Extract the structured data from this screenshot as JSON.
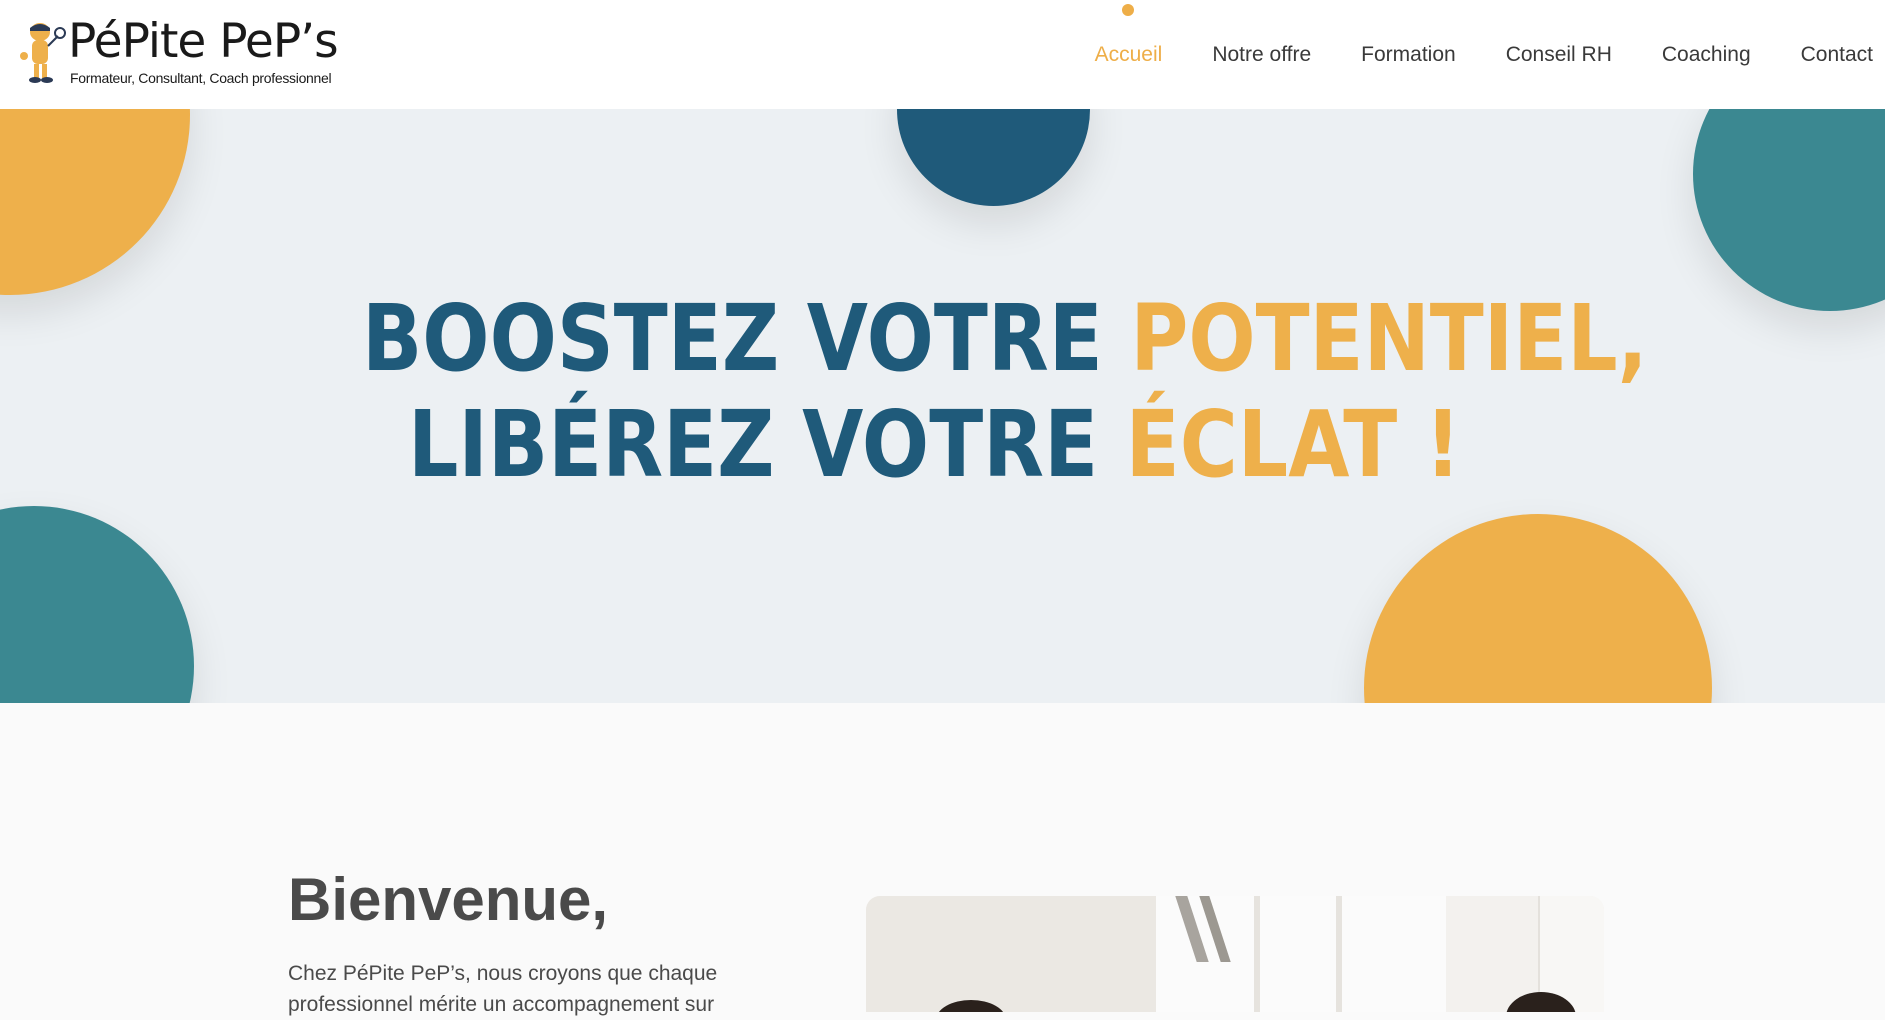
{
  "brand": {
    "name": "PéPite PeP’s",
    "tagline": "Formateur, Consultant, Coach professionnel"
  },
  "nav": {
    "items": [
      {
        "label": "Accueil",
        "active": true
      },
      {
        "label": "Notre offre",
        "active": false
      },
      {
        "label": "Formation",
        "active": false
      },
      {
        "label": "Conseil RH",
        "active": false
      },
      {
        "label": "Coaching",
        "active": false
      },
      {
        "label": "Contact",
        "active": false
      }
    ]
  },
  "hero": {
    "line1_a": "BOOSTEZ VOTRE ",
    "line1_b": "POTENTIEL,",
    "line2_a": "LIBÉREZ VOTRE ",
    "line2_b": "ÉCLAT !"
  },
  "welcome": {
    "title": "Bienvenue,",
    "text": "Chez PéPite PeP’s, nous croyons que chaque professionnel mérite un accompagnement sur"
  },
  "colors": {
    "accent": "#eeb04b",
    "navy": "#1f5a7a",
    "teal": "#3b8891",
    "hero_bg": "#ecf0f3",
    "page_bg": "#fafafa"
  }
}
